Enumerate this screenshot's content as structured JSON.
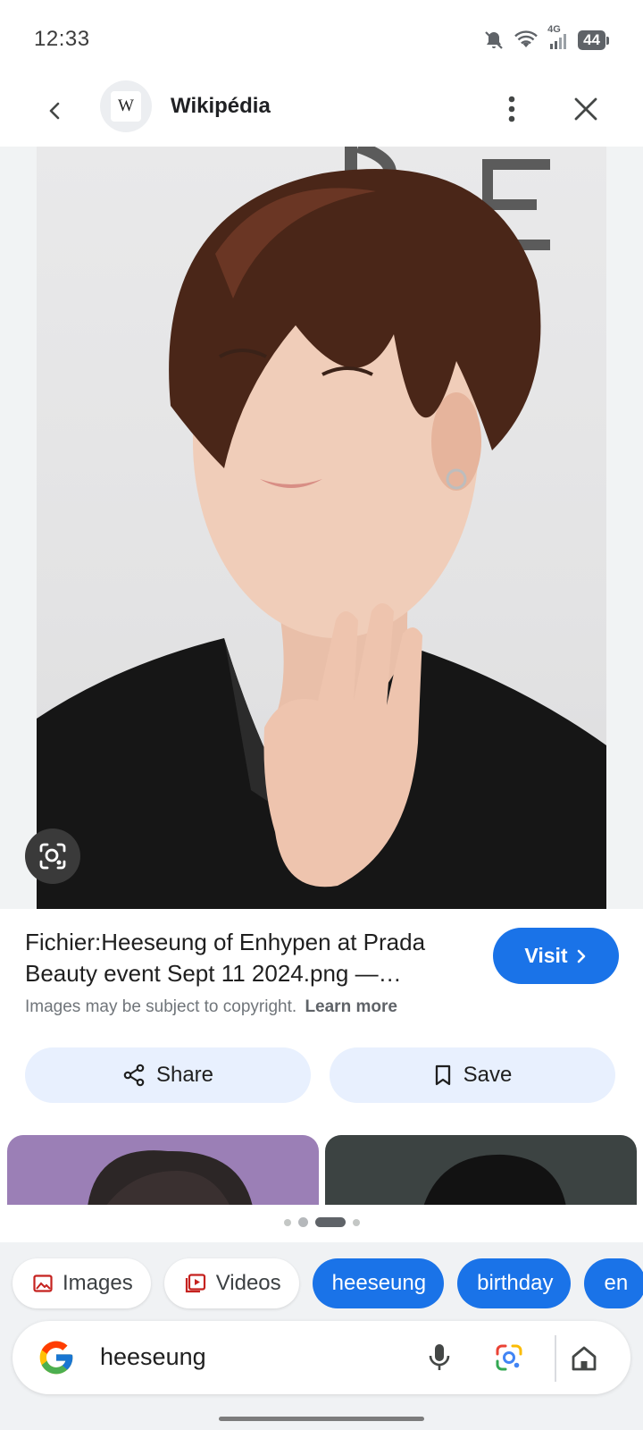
{
  "status_bar": {
    "time": "12:33",
    "network_label": "4G",
    "battery_level": "44"
  },
  "header": {
    "site_logo_letter": "W",
    "site_name": "Wikipédia"
  },
  "result": {
    "title": "Fichier:Heeseung of Enhypen at Prada Beauty event Sept 11 2024.png —…",
    "visit_label": "Visit",
    "copyright_notice": "Images may be subject to copyright.",
    "learn_more_label": "Learn more",
    "share_label": "Share",
    "save_label": "Save"
  },
  "carousel": {
    "pages": 4,
    "active_index": 2
  },
  "chips": [
    {
      "label": "Images",
      "style": "white",
      "icon": "image-icon"
    },
    {
      "label": "Videos",
      "style": "white",
      "icon": "video-icon"
    },
    {
      "label": "heeseung",
      "style": "blue"
    },
    {
      "label": "birthday",
      "style": "blue"
    },
    {
      "label": "en",
      "style": "blue"
    }
  ],
  "search": {
    "query": "heeseung"
  },
  "colors": {
    "accent_blue": "#1a73e8",
    "pill_bg": "#e8f0fe",
    "chip_icon_red": "#c5221f"
  }
}
